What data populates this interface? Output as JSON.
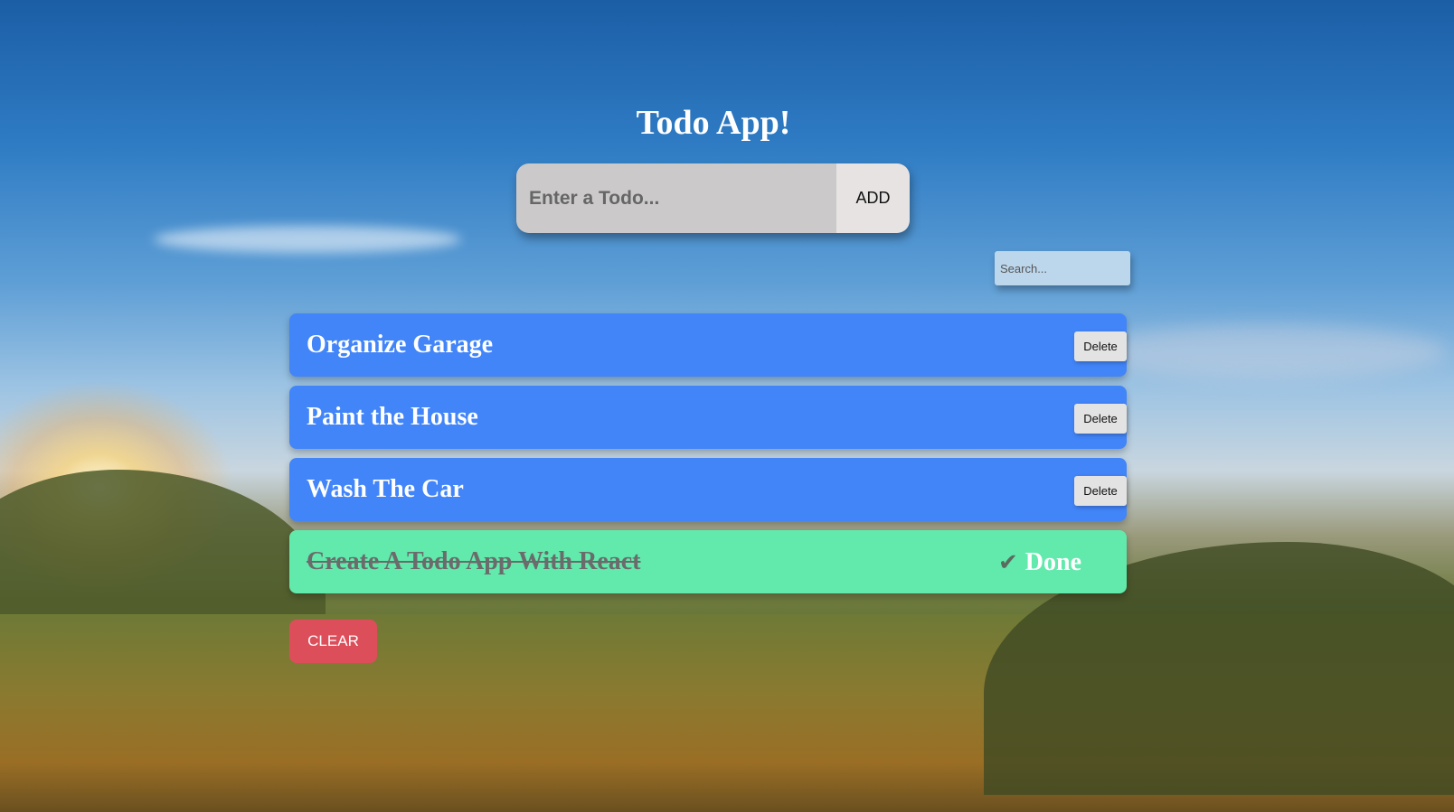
{
  "app": {
    "title": "Todo App!"
  },
  "add_form": {
    "placeholder": "Enter a Todo...",
    "add_label": "ADD"
  },
  "search": {
    "placeholder": "Search..."
  },
  "todos": [
    {
      "text": "Organize Garage",
      "completed": false,
      "delete_label": "Delete"
    },
    {
      "text": "Paint the House",
      "completed": false,
      "delete_label": "Delete"
    },
    {
      "text": "Wash The Car",
      "completed": false,
      "delete_label": "Delete"
    },
    {
      "text": "Create A Todo App With React",
      "completed": true,
      "status_label": "Done",
      "status_icon": "check-icon"
    }
  ],
  "clear_label": "CLEAR",
  "colors": {
    "pending_item": "#4285f9",
    "done_item": "#62e9ac",
    "clear_button": "#dd4e5b"
  }
}
